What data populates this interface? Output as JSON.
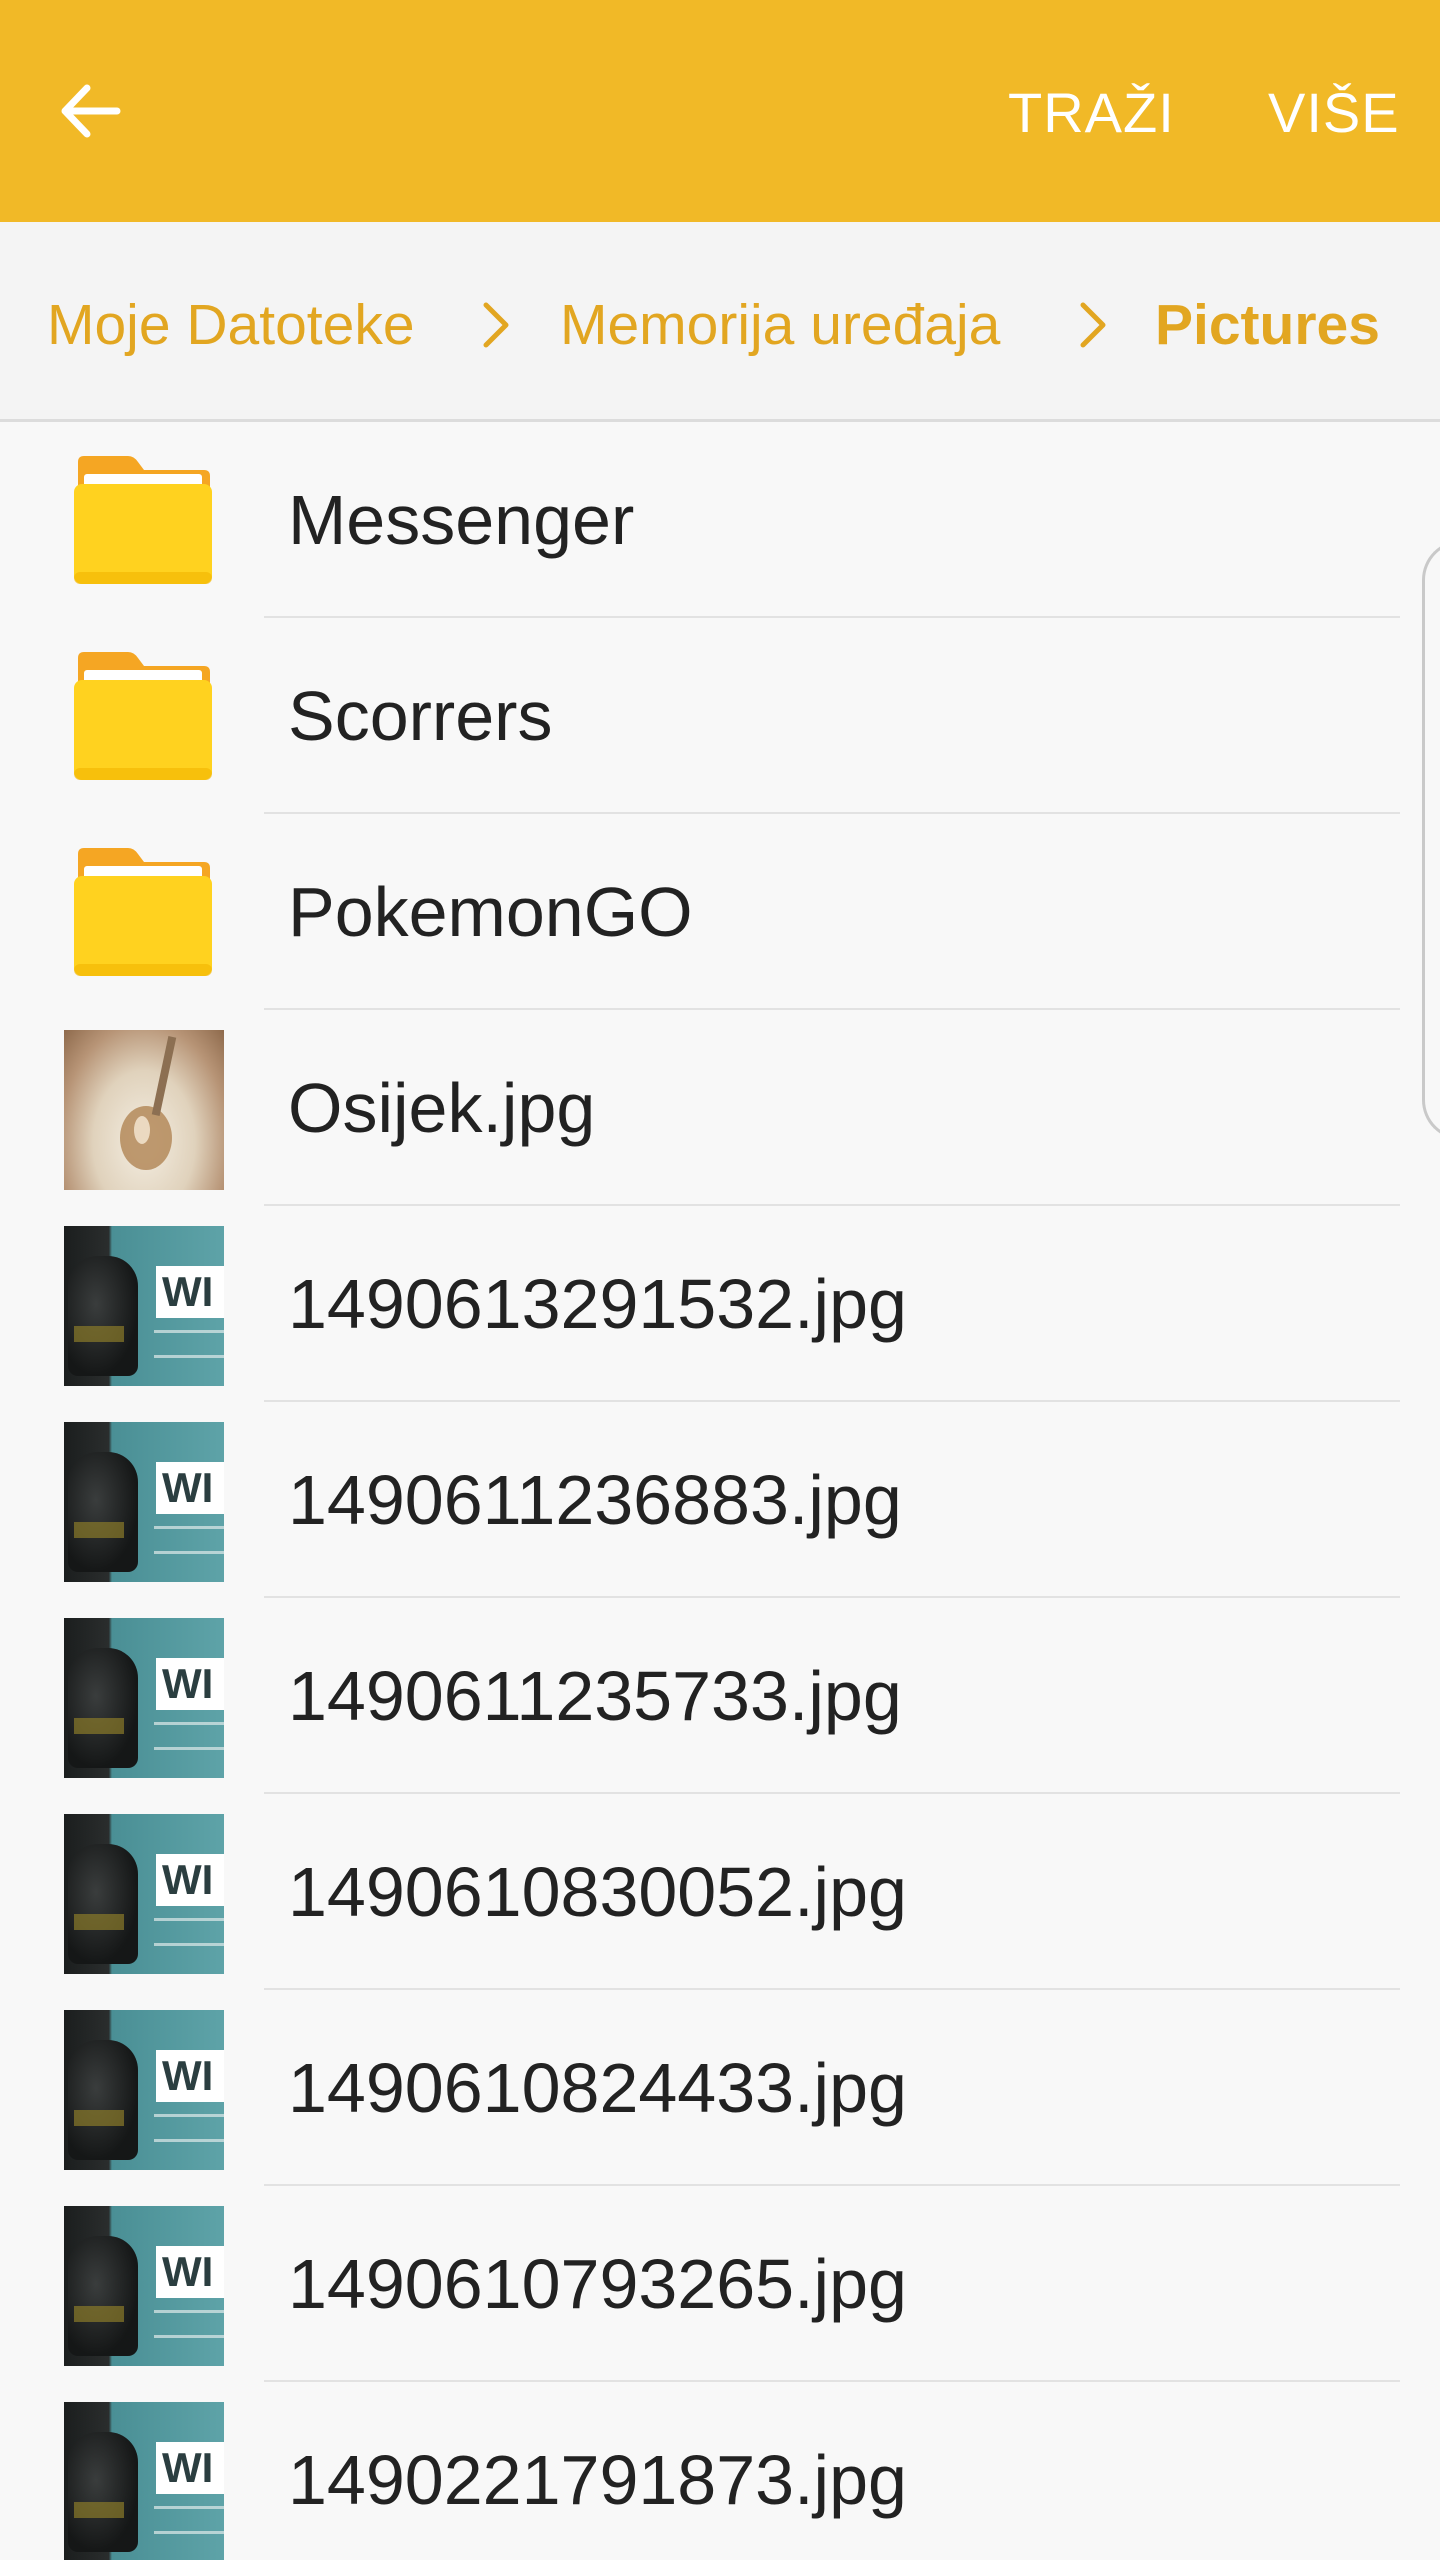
{
  "appbar": {
    "back_icon": "arrow-left-icon",
    "search_label": "TRAŽI",
    "more_label": "VIŠE",
    "color": "#f1b927"
  },
  "breadcrumb": {
    "items": [
      {
        "label": "Moje Datoteke"
      },
      {
        "label": "Memorija uređaja"
      },
      {
        "label": "Pictures",
        "current": true
      }
    ],
    "color": "#e2a621",
    "separator_icon": "chevron-right-icon"
  },
  "files": [
    {
      "name": "Messenger",
      "kind": "folder"
    },
    {
      "name": "Scorrers",
      "kind": "folder"
    },
    {
      "name": "PokemonGO",
      "kind": "folder"
    },
    {
      "name": "Osijek.jpg",
      "kind": "image"
    },
    {
      "name": "1490613291532.jpg",
      "kind": "image"
    },
    {
      "name": "1490611236883.jpg",
      "kind": "image"
    },
    {
      "name": "1490611235733.jpg",
      "kind": "image"
    },
    {
      "name": "1490610830052.jpg",
      "kind": "image"
    },
    {
      "name": "1490610824433.jpg",
      "kind": "image"
    },
    {
      "name": "1490610793265.jpg",
      "kind": "image"
    },
    {
      "name": "1490221791873.jpg",
      "kind": "image"
    }
  ],
  "thumb_text": "WI"
}
